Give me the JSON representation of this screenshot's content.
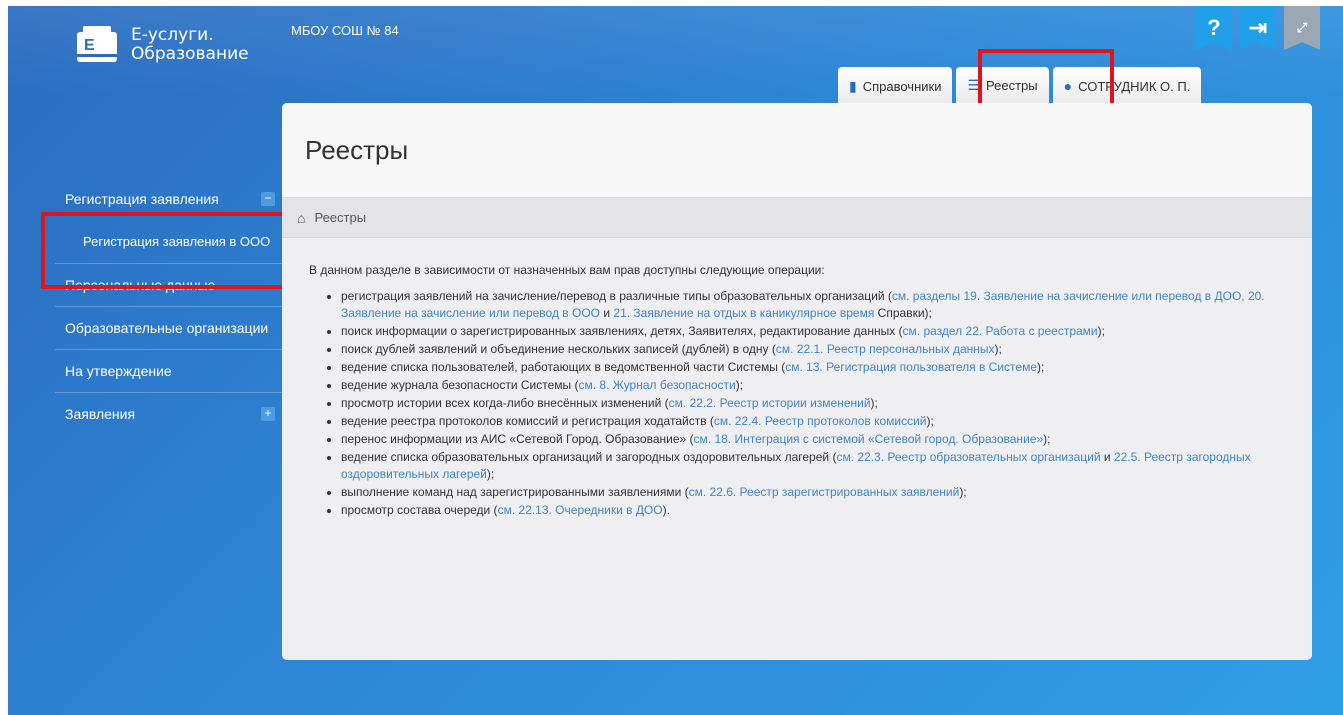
{
  "app": {
    "logo_line1": "Е-услуги.",
    "logo_line2": "Образование",
    "org_name": "МБОУ СОШ № 84"
  },
  "top_icons": {
    "help": "?",
    "logout": "⇥",
    "fullscreen": "⤢"
  },
  "tabs": [
    {
      "label": "Справочники",
      "icon": "book-icon"
    },
    {
      "label": "Реестры",
      "icon": "list-icon",
      "active": true
    },
    {
      "label": "СОТРУДНИК О. П.",
      "icon": "user-icon"
    }
  ],
  "sidebar": {
    "items": [
      {
        "label": "Регистрация заявления",
        "toggle": "−"
      },
      {
        "label": "Регистрация заявления в ООО"
      },
      {
        "label": "Персональные данные"
      },
      {
        "label": "Образовательные организации"
      },
      {
        "label": "На утверждение"
      },
      {
        "label": "Заявления",
        "toggle": "+"
      }
    ]
  },
  "main": {
    "title": "Реестры",
    "breadcrumb": "Реестры",
    "intro": "В данном разделе в зависимости от назначенных вам прав доступны следующие операции:",
    "items": [
      {
        "segments": [
          {
            "t": "регистрация заявлений на зачисление/перевод в различные типы образовательных организаций ("
          },
          {
            "t": "см. разделы 19. Заявление на зачисление или перевод в ДОО, 20. Заявление на зачисление или перевод в ООО",
            "link": true
          },
          {
            "t": " и "
          },
          {
            "t": "21. Заявление на отдых в каникулярное время",
            "link": true
          },
          {
            "t": " Справки);"
          }
        ]
      },
      {
        "segments": [
          {
            "t": "поиск информации о зарегистрированных заявлениях, детях, Заявителях, редактирование данных ("
          },
          {
            "t": "см. раздел 22. Работа с реестрами",
            "link": true
          },
          {
            "t": ");"
          }
        ]
      },
      {
        "segments": [
          {
            "t": "поиск дублей заявлений и объединение нескольких записей (дублей) в одну ("
          },
          {
            "t": "см. 22.1. Реестр персональных данных",
            "link": true
          },
          {
            "t": ");"
          }
        ]
      },
      {
        "segments": [
          {
            "t": "ведение списка пользователей, работающих в ведомственной части Системы ("
          },
          {
            "t": "см. 13. Регистрация пользователя в Системе",
            "link": true
          },
          {
            "t": ");"
          }
        ]
      },
      {
        "segments": [
          {
            "t": "ведение журнала безопасности Системы ("
          },
          {
            "t": "см. 8. Журнал безопасности",
            "link": true
          },
          {
            "t": ");"
          }
        ]
      },
      {
        "segments": [
          {
            "t": "просмотр истории всех когда-либо внесённых изменений ("
          },
          {
            "t": "см. 22.2. Реестр истории изменений",
            "link": true
          },
          {
            "t": ");"
          }
        ]
      },
      {
        "segments": [
          {
            "t": "ведение реестра протоколов комиссий и регистрация ходатайств ("
          },
          {
            "t": "см. 22.4. Реестр протоколов комиссий",
            "link": true
          },
          {
            "t": ");"
          }
        ]
      },
      {
        "segments": [
          {
            "t": "перенос информации из АИС «Сетевой Город. Образование» ("
          },
          {
            "t": "см. 18. Интеграция с системой «Сетевой город. Образование»",
            "link": true
          },
          {
            "t": ");"
          }
        ]
      },
      {
        "segments": [
          {
            "t": "ведение списка образовательных организаций и загородных оздоровительных лагерей ("
          },
          {
            "t": "см. 22.3. Реестр образовательных организаций",
            "link": true
          },
          {
            "t": " и "
          },
          {
            "t": "22.5. Реестр загородных оздоровительных лагерей",
            "link": true
          },
          {
            "t": ");"
          }
        ]
      },
      {
        "segments": [
          {
            "t": "выполнение команд над зарегистрированными заявлениями ("
          },
          {
            "t": "см. 22.6. Реестр зарегистрированных заявлений",
            "link": true
          },
          {
            "t": ");"
          }
        ]
      },
      {
        "segments": [
          {
            "t": "просмотр состава очереди ("
          },
          {
            "t": "см. 22.13. Очередники в ДОО",
            "link": true
          },
          {
            "t": ")."
          }
        ]
      }
    ]
  },
  "colors": {
    "accent": "#2e86d6",
    "link": "#3f86c9",
    "highlight_box": "#e0141e",
    "active_tab_underline": "#f18a2a"
  }
}
